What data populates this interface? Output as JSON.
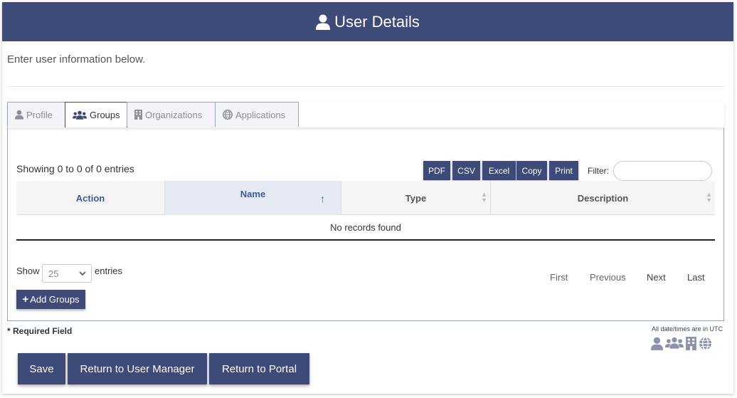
{
  "header": {
    "title": "User Details",
    "icon": "user-icon"
  },
  "intro": "Enter user information below.",
  "tabs": [
    {
      "label": "Profile",
      "icon": "user-icon"
    },
    {
      "label": "Groups",
      "icon": "users-icon"
    },
    {
      "label": "Organizations",
      "icon": "building-icon"
    },
    {
      "label": "Applications",
      "icon": "globe-icon"
    }
  ],
  "active_tab": "Groups",
  "table": {
    "info": "Showing 0 to 0 of 0 entries",
    "export_buttons": [
      "PDF",
      "CSV",
      "Excel",
      "Copy",
      "Print"
    ],
    "filter_label": "Filter:",
    "filter_value": "",
    "columns": [
      "Action",
      "Name",
      "Type",
      "Description"
    ],
    "sorted_column": "Name",
    "empty_message": "No records found",
    "show_label": "Show",
    "page_size": "25",
    "entries_label": "entries",
    "pagination": [
      "First",
      "Previous",
      "Next",
      "Last"
    ]
  },
  "add_button": "Add Groups",
  "required_note": "* Required Field",
  "utc_note": "All date/times are in UTC",
  "legend_icons": [
    "user-icon",
    "users-icon",
    "building-icon",
    "globe-icon"
  ],
  "footer_buttons": [
    "Save",
    "Return to User Manager",
    "Return to Portal"
  ],
  "colors": {
    "primary": "#3e4a78",
    "link": "#3e5a99"
  }
}
